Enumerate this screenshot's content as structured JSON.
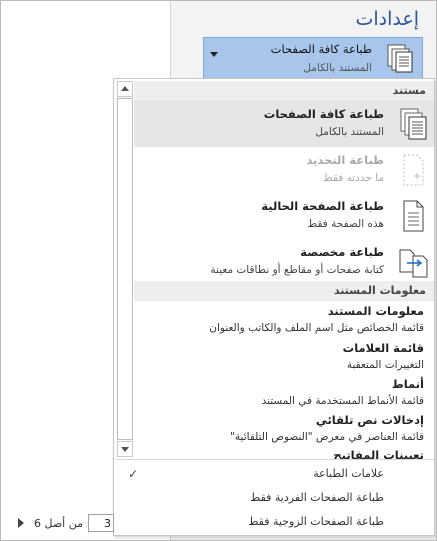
{
  "title": "إعدادات",
  "print_dropdown": {
    "label": "طباعة كافة الصفحات",
    "sublabel": "المستند بالكامل"
  },
  "menu": {
    "section_document": "مستند",
    "items": [
      {
        "label": "طباعة كافة الصفحات",
        "desc": "المستند بالكامل"
      },
      {
        "label": "طباعة التحديد",
        "desc": "ما حددته فقط"
      },
      {
        "label": "طباعة الصفحة الحالية",
        "desc": "هذه الصفحة فقط"
      },
      {
        "label": "طباعة مخصصة",
        "desc": "كتابة صفحات أو مقاطع أو نطاقات معينة"
      }
    ],
    "section_info": "معلومات المستند",
    "info_items": [
      {
        "label": "معلومات المستند",
        "desc": "قائمة الخصائص مثل اسم الملف والكاتب والعنوان"
      },
      {
        "label": "قائمة العلامات",
        "desc": "التغييرات المتعقبة"
      },
      {
        "label": "أنماط",
        "desc": "قائمة الأنماط المستخدمة في المستند"
      },
      {
        "label": "إدخالات نص تلقائي",
        "desc": "قائمة العناصر في معرض \"النصوص التلقائية\""
      },
      {
        "label": "تعيينات المفاتيح",
        "desc": ""
      }
    ],
    "options": [
      {
        "label": "علامات الطباعة",
        "checked": true
      },
      {
        "label": "طباعة الصفحات الفردية فقط",
        "checked": false
      },
      {
        "label": "طباعة الصفحات الزوجية فقط",
        "checked": false
      }
    ],
    "check_glyph": "✓"
  },
  "pager": {
    "current": "3",
    "of_text": "من أصل 6"
  }
}
